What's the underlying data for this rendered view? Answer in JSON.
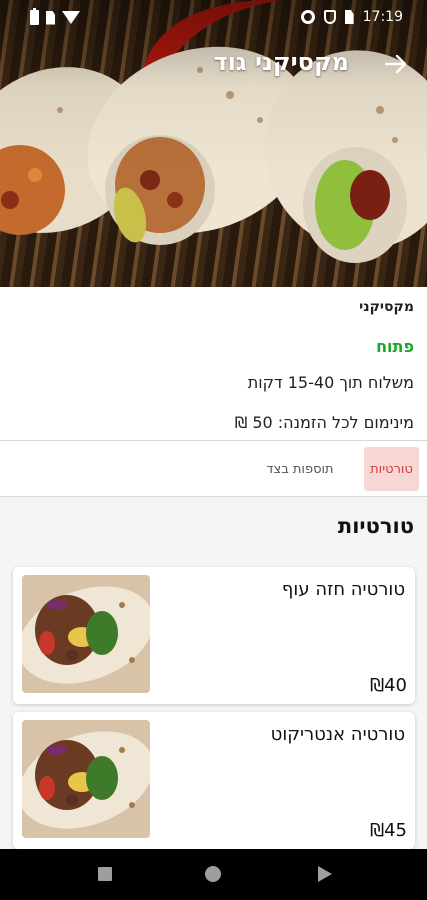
{
  "status_bar": {
    "time": "17:19"
  },
  "header": {
    "title": "מקסיקני גוד"
  },
  "restaurant": {
    "name": "מקסיקני",
    "status": "פתוח",
    "delivery": "משלוח תוך 15-40 דקות",
    "minimum": "מינימום לכל הזמנה:  50 ₪"
  },
  "tabs": [
    {
      "label": "טורטיות",
      "active": true
    },
    {
      "label": "תוספות בצד",
      "active": false
    }
  ],
  "menu": {
    "section_title": "טורטיות",
    "items": [
      {
        "name": "טורטיה חזה עוף",
        "price": "₪40"
      },
      {
        "name": "טורטיה אנטריקוט",
        "price": "₪45"
      }
    ]
  },
  "colors": {
    "accent": "#d04040",
    "open_status": "#19a82c",
    "active_tab_bg": "#f7d6d6"
  }
}
